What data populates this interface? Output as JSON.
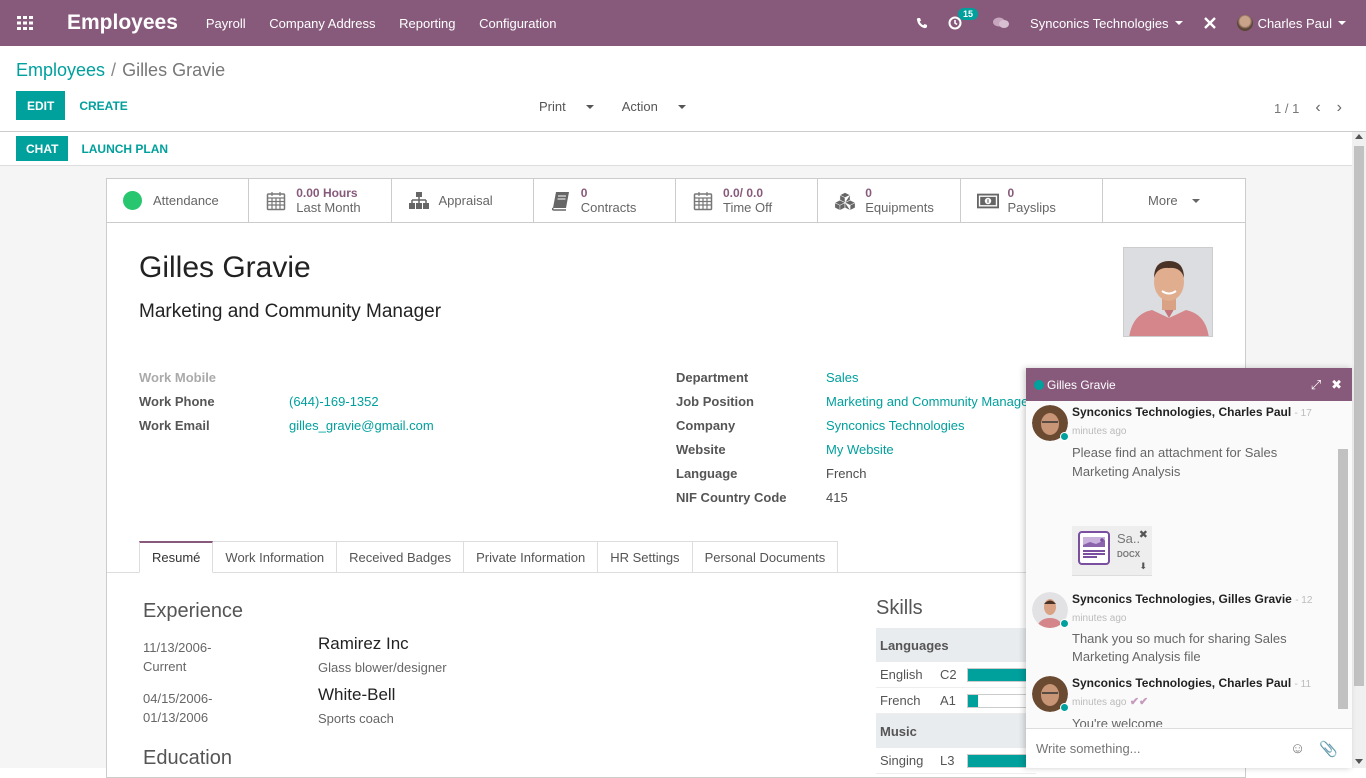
{
  "topbar": {
    "app_title": "Employees",
    "menu": [
      "Payroll",
      "Company Address",
      "Reporting",
      "Configuration"
    ],
    "activity_count": "15",
    "company": "Synconics Technologies",
    "user": "Charles Paul",
    "bg_color": "#875a7b"
  },
  "breadcrumb": {
    "parent": "Employees",
    "separator": "/",
    "current": "Gilles Gravie"
  },
  "control": {
    "edit": "EDIT",
    "create": "CREATE",
    "print": "Print",
    "action": "Action",
    "pager": "1 / 1"
  },
  "statusbar": {
    "chat": "CHAT",
    "launch_plan": "LAUNCH PLAN"
  },
  "smart_buttons": [
    {
      "label": "Attendance"
    },
    {
      "value": "0.00 Hours",
      "label": "Last Month"
    },
    {
      "label": "Appraisal"
    },
    {
      "value": "0",
      "label": "Contracts"
    },
    {
      "value": "0.0/ 0.0",
      "label": "Time Off"
    },
    {
      "value": "0",
      "label": "Equipments"
    },
    {
      "value": "0",
      "label": "Payslips"
    },
    {
      "label": "More"
    }
  ],
  "employee": {
    "name": "Gilles Gravie",
    "job_title": "Marketing and Community Manager"
  },
  "left_fields": [
    {
      "label": "Work Mobile",
      "value": ""
    },
    {
      "label": "Work Phone",
      "value": "(644)-169-1352"
    },
    {
      "label": "Work Email",
      "value": "gilles_gravie@gmail.com"
    }
  ],
  "right_fields": [
    {
      "label": "Department",
      "value": "Sales"
    },
    {
      "label": "Job Position",
      "value": "Marketing and Community Manager"
    },
    {
      "label": "Company",
      "value": "Synconics Technologies"
    },
    {
      "label": "Website",
      "value": "My Website"
    },
    {
      "label": "Language",
      "value": "French"
    },
    {
      "label": "NIF Country Code",
      "value": "415"
    }
  ],
  "tabs": [
    "Resumé",
    "Work Information",
    "Received Badges",
    "Private Information",
    "HR Settings",
    "Personal Documents"
  ],
  "resume": {
    "experience_title": "Experience",
    "experience": [
      {
        "start": "11/13/2006-",
        "end": "Current",
        "company": "Ramirez Inc",
        "role": "Glass blower/designer"
      },
      {
        "start": "04/15/2006-",
        "end": "01/13/2006",
        "company": "White-Bell",
        "role": "Sports coach"
      }
    ],
    "education_title": "Education"
  },
  "skills": {
    "title": "Skills",
    "groups": [
      {
        "name": "Languages",
        "items": [
          {
            "name": "English",
            "level": "C2",
            "progress": 100
          },
          {
            "name": "French",
            "level": "A1",
            "progress": 15
          }
        ]
      },
      {
        "name": "Music",
        "items": [
          {
            "name": "Singing",
            "level": "L3",
            "progress": 100
          }
        ]
      }
    ]
  },
  "chat": {
    "title": "Gilles Gravie",
    "messages": [
      {
        "author": "Synconics Technologies, Charles Paul",
        "time": "- 17",
        "time2": "minutes ago",
        "text": "Please find an attachment for Sales Marketing Analysis"
      },
      {
        "author": "Synconics Technologies, Gilles Gravie",
        "time": "- 12",
        "time2": "minutes ago",
        "text": "Thank you so much for sharing Sales Marketing Analysis file"
      },
      {
        "author": "Synconics Technologies, Charles Paul",
        "time": "- 11",
        "time2": "minutes ago",
        "text": "You're welcome"
      }
    ],
    "attachment": {
      "name": "Sa..",
      "ext": "DOCX"
    },
    "input_placeholder": "Write something..."
  }
}
